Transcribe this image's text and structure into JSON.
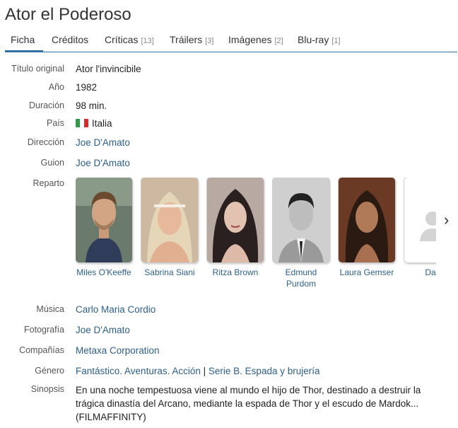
{
  "title": "Ator el Poderoso",
  "tabs": [
    {
      "label": "Ficha",
      "count": ""
    },
    {
      "label": "Créditos",
      "count": ""
    },
    {
      "label": "Críticas",
      "count": "[13]"
    },
    {
      "label": "Tráilers",
      "count": "[3]"
    },
    {
      "label": "Imágenes",
      "count": "[2]"
    },
    {
      "label": "Blu-ray",
      "count": "[1]"
    }
  ],
  "fields": {
    "original_title": {
      "label": "Título original",
      "value": "Ator l'invincibile"
    },
    "year": {
      "label": "Año",
      "value": "1982"
    },
    "duration": {
      "label": "Duración",
      "value": "98 min."
    },
    "country": {
      "label": "País",
      "value": "Italia",
      "flag_colors": [
        "#2e9a4a",
        "#ffffff",
        "#d52b2b"
      ]
    },
    "direction": {
      "label": "Dirección",
      "value": "Joe D'Amato"
    },
    "script": {
      "label": "Guion",
      "value": "Joe D'Amato"
    },
    "cast": {
      "label": "Reparto"
    },
    "music": {
      "label": "Música",
      "value": "Carlo Maria Cordio"
    },
    "photography": {
      "label": "Fotografía",
      "value": "Joe D'Amato"
    },
    "companies": {
      "label": "Compañías",
      "value": "Metaxa Corporation"
    },
    "genre": {
      "label": "Género",
      "value_1": "Fantástico. Aventuras. Acción",
      "separator": "|",
      "value_2": "Serie B. Espada y brujería"
    },
    "synopsis": {
      "label": "Sinopsis",
      "value": "En una noche tempestuosa viene al mundo el hijo de Thor, destinado a destruir la trágica dinastía del Arcano, mediante la espada de Thor y el escudo de Mardok... (FILMAFFINITY)"
    }
  },
  "cast": [
    {
      "name": "Miles O'Keeffe"
    },
    {
      "name": "Sabrina Siani"
    },
    {
      "name": "Ritza Brown"
    },
    {
      "name": "Edmund Purdom"
    },
    {
      "name": "Laura Gemser"
    },
    {
      "name": "Dak"
    }
  ],
  "colors": {
    "accent": "#2f6fa6",
    "link": "#2c5f8a"
  }
}
